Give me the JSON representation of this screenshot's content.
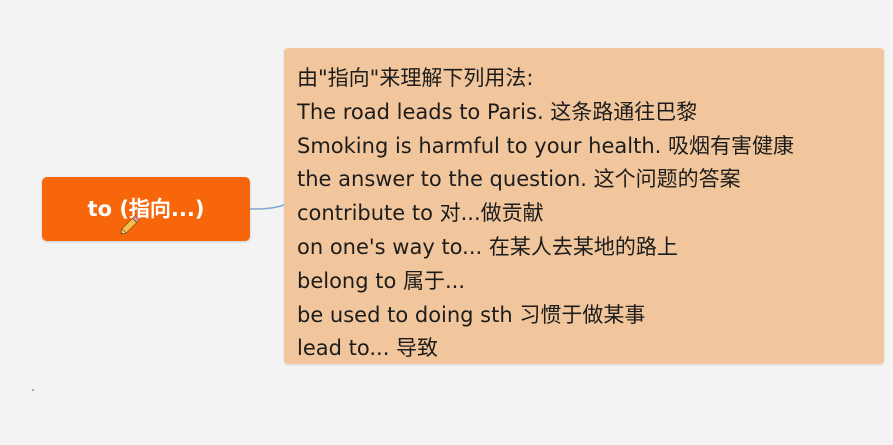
{
  "topic": {
    "label": "to (指向...)",
    "color": "#f7660a",
    "icon": "pencil-icon"
  },
  "note": {
    "background": "#f2c69c",
    "lines": [
      "由\"指向\"来理解下列用法:",
      "The road leads to Paris. 这条路通往巴黎",
      "Smoking is harmful to your health. 吸烟有害健康",
      "the answer to the question. 这个问题的答案",
      "contribute to 对...做贡献",
      "on one's way to... 在某人去某地的路上",
      "belong to 属于...",
      "be used to doing sth 习惯于做某事",
      "lead to... 导致"
    ]
  }
}
